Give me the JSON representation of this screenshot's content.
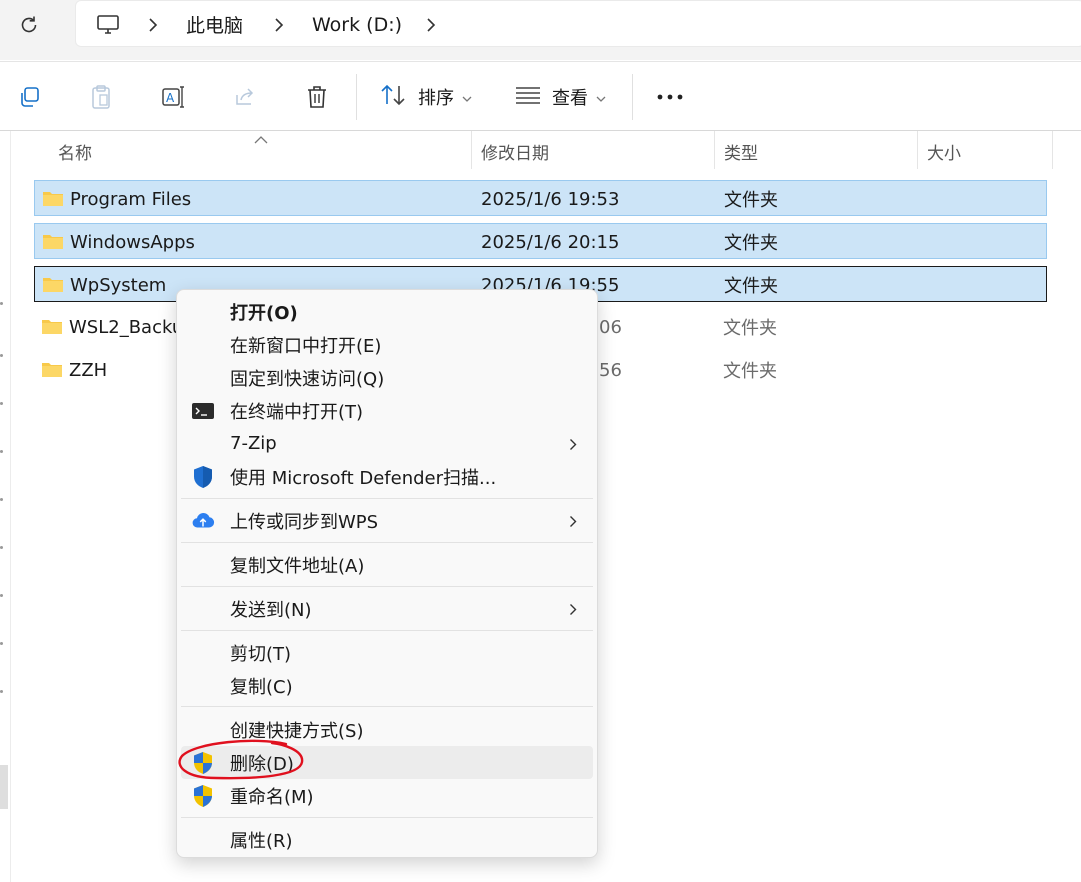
{
  "address_bar": {
    "breadcrumb": [
      "此电脑",
      "Work (D:)"
    ]
  },
  "toolbar": {
    "sort_label": "排序",
    "view_label": "查看"
  },
  "columns": [
    "名称",
    "修改日期",
    "类型",
    "大小"
  ],
  "rows": [
    {
      "name": "Program Files",
      "date": "2025/1/6 19:53",
      "type": "文件夹"
    },
    {
      "name": "WindowsApps",
      "date": "2025/1/6 20:15",
      "type": "文件夹"
    },
    {
      "name": "WpSystem",
      "date": "2025/1/6 19:55",
      "type": "文件夹"
    },
    {
      "name": "WSL2_Backu",
      "date": "06",
      "type": "文件夹"
    },
    {
      "name": "ZZH",
      "date": "56",
      "type": "文件夹"
    }
  ],
  "context_menu": {
    "items": [
      {
        "label": "打开(O)"
      },
      {
        "label": "在新窗口中打开(E)"
      },
      {
        "label": "固定到快速访问(Q)"
      },
      {
        "label": "在终端中打开(T)",
        "icon": "terminal-icon"
      },
      {
        "label": "7-Zip"
      },
      {
        "label": "使用 Microsoft Defender扫描...",
        "icon": "defender-shield-icon"
      },
      {
        "label": "上传或同步到WPS",
        "icon": "cloud-upload-icon"
      },
      {
        "label": "复制文件地址(A)"
      },
      {
        "label": "发送到(N)"
      },
      {
        "label": "剪切(T)"
      },
      {
        "label": "复制(C)"
      },
      {
        "label": "创建快捷方式(S)"
      },
      {
        "label": "删除(D)",
        "icon": "uac-shield-icon"
      },
      {
        "label": "重命名(M)",
        "icon": "uac-shield-icon"
      },
      {
        "label": "属性(R)"
      }
    ]
  },
  "colors": {
    "selection": "#cce4f7",
    "selection_border": "#99c9ef",
    "folder": "#f8c94a",
    "annotation": "#e0101e"
  }
}
